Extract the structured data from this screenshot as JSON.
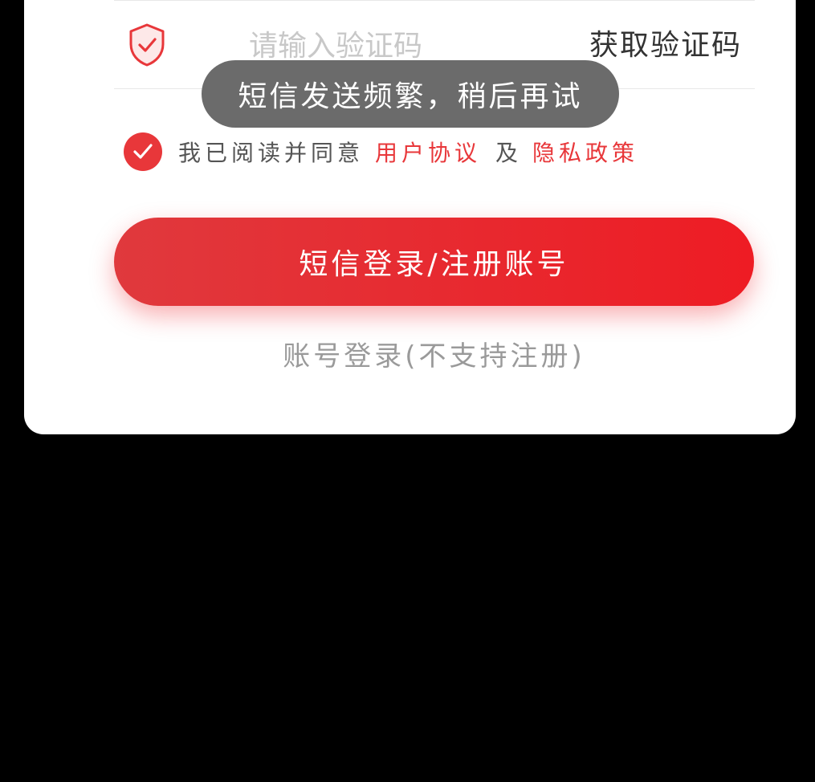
{
  "code_field": {
    "placeholder": "请输入验证码",
    "value": "",
    "get_code_label": "获取验证码",
    "icon": "shield-check-icon"
  },
  "toast": {
    "message": "短信发送频繁，稍后再试"
  },
  "agreement": {
    "checked": true,
    "prefix": "我已阅读并同意",
    "user_agreement": "用户协议",
    "and": "及",
    "privacy_policy": "隐私政策"
  },
  "primary_button": {
    "label": "短信登录/注册账号"
  },
  "secondary_link": {
    "label": "账号登录(不支持注册)"
  },
  "colors": {
    "accent": "#ee1c24",
    "background": "#000000",
    "card": "#ffffff",
    "toast_bg": "#6b6b6b"
  }
}
